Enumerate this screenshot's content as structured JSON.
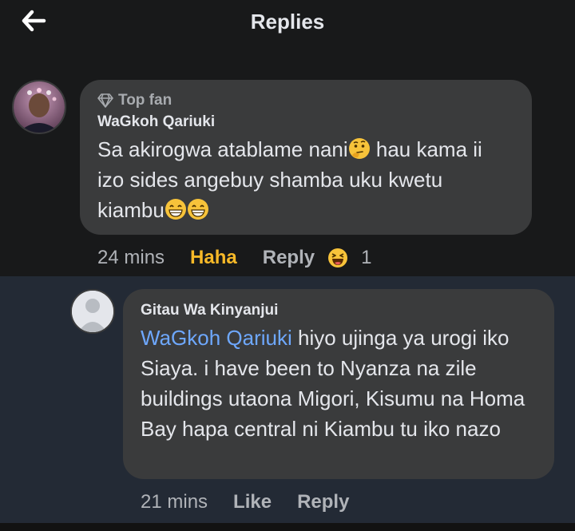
{
  "header": {
    "title": "Replies",
    "back_icon": "arrow-left-icon"
  },
  "comment": {
    "badge": "Top fan",
    "badge_icon": "diamond-icon",
    "author": "WaGkoh Qariuki",
    "text_part1": "Sa akirogwa atablame nani",
    "text_part2": " hau kama ii izo sides angebuy shamba uku kwetu kiambu",
    "emojis": [
      "thinking-face",
      "grinning-face",
      "grinning-face"
    ],
    "time": "24 mins",
    "reaction_label": "Haha",
    "reply_label": "Reply",
    "reaction_icon": "laughing-face-icon",
    "reaction_count": "1"
  },
  "reply": {
    "author": "Gitau Wa Kinyanjui",
    "mention": "WaGkoh Qariuki",
    "text": " hiyo ujinga ya urogi iko Siaya. i have been to Nyanza na zile buildings utaona Migori, Kisumu na Homa Bay hapa central ni Kiambu tu iko nazo",
    "time": "21 mins",
    "like_label": "Like",
    "reply_label": "Reply"
  },
  "colors": {
    "background": "#18191a",
    "bubble": "#3a3b3c",
    "reply_section": "#232a35",
    "haha": "#f7b928",
    "mention": "#6ea8fe"
  }
}
